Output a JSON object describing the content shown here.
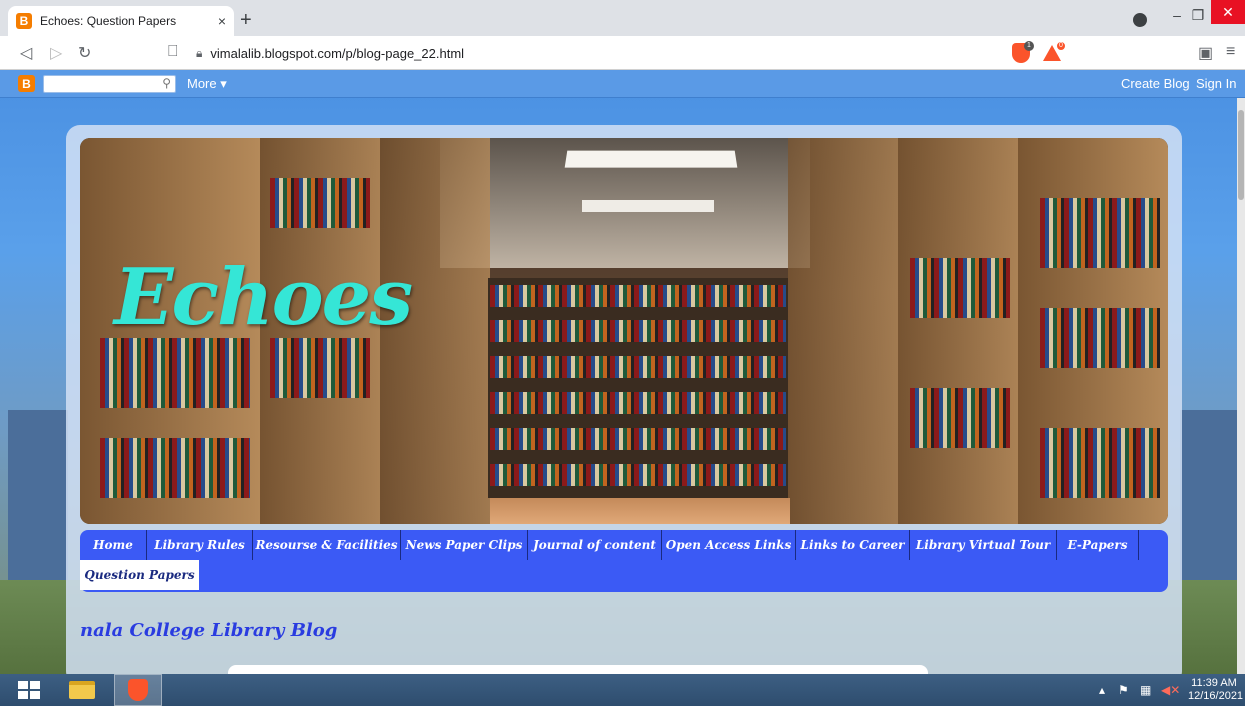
{
  "browser": {
    "tab_title": "Echoes: Question Papers",
    "tab_favicon": "B",
    "tab_close": "×",
    "new_tab": "+",
    "url": "vimalalib.blogspot.com/p/blog-page_22.html",
    "shield_count": "1",
    "rewards_count": "0",
    "icons": [
      "back-icon",
      "forward-icon",
      "reload-icon",
      "bookmark-icon",
      "lock-icon",
      "wallet-icon",
      "menu-icon"
    ]
  },
  "blogger_bar": {
    "logo": "B",
    "search_placeholder": "",
    "more_label": "More ▾",
    "create_blog": "Create Blog",
    "sign_in": "Sign In"
  },
  "header": {
    "title": "Echoes"
  },
  "menu": {
    "items": [
      "Home",
      "Library Rules",
      "Resourse & Facilities",
      "News Paper Clips",
      "Journal of content",
      "Open Access Links",
      "Links to Career",
      "Library Virtual Tour",
      "E-Papers",
      "Question Papers"
    ],
    "active": "Question Papers"
  },
  "blog_title": "nala College Library Blog",
  "taskbar": {
    "time": "11:39 AM",
    "date": "12/16/2021"
  },
  "colors": {
    "menu_bg": "#3b5af5",
    "echoes_text": "#35e6d6",
    "blog_title": "#2a3ce0",
    "blogger_orange": "#f57d00",
    "brave_orange": "#fb542b"
  }
}
